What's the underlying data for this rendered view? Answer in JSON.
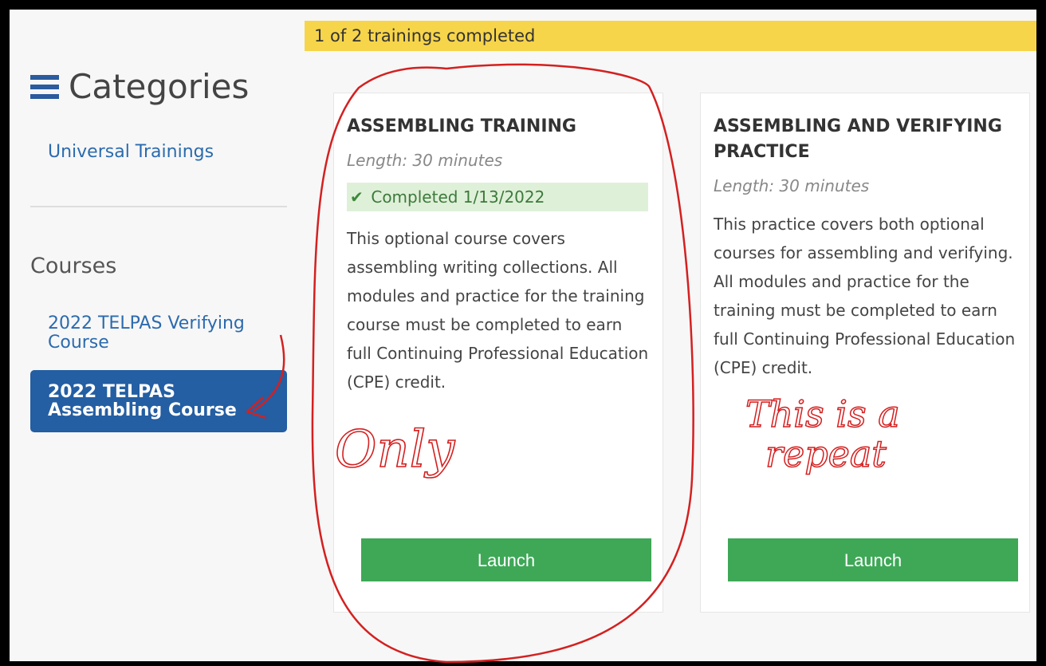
{
  "progress": {
    "text": "1 of 2 trainings completed"
  },
  "sidebar": {
    "categories_title": "Categories",
    "categories": [
      {
        "label": "Universal Trainings"
      }
    ],
    "courses_title": "Courses",
    "courses": [
      {
        "label": "2022 TELPAS Verifying Course",
        "active": false
      },
      {
        "label": "2022 TELPAS Assembling Course",
        "active": true
      }
    ]
  },
  "cards": [
    {
      "title": "ASSEMBLING TRAINING",
      "length": "Length: 30 minutes",
      "completed": "Completed 1/13/2022",
      "description": "This optional course covers assembling writing collections. All modules and practice for the training course must be completed to earn full Continuing Professional Education (CPE) credit.",
      "button": "Launch"
    },
    {
      "title": "ASSEMBLING AND VERIFYING PRACTICE",
      "length": "Length: 30 minutes",
      "description": "This practice covers both optional courses for assembling and verifying. All modules and practice for the training must be completed to earn full Continuing Professional Education (CPE) credit.",
      "button": "Launch"
    }
  ],
  "annotations": {
    "note_left": "Only",
    "note_right_line1": "This is a",
    "note_right_line2": "repeat"
  },
  "colors": {
    "accent_blue": "#245ea3",
    "link_blue": "#2b6bae",
    "progress_yellow": "#f7d54a",
    "launch_green": "#3ea857",
    "completed_bg": "#dff0d8",
    "annotation_red": "#d42020"
  }
}
